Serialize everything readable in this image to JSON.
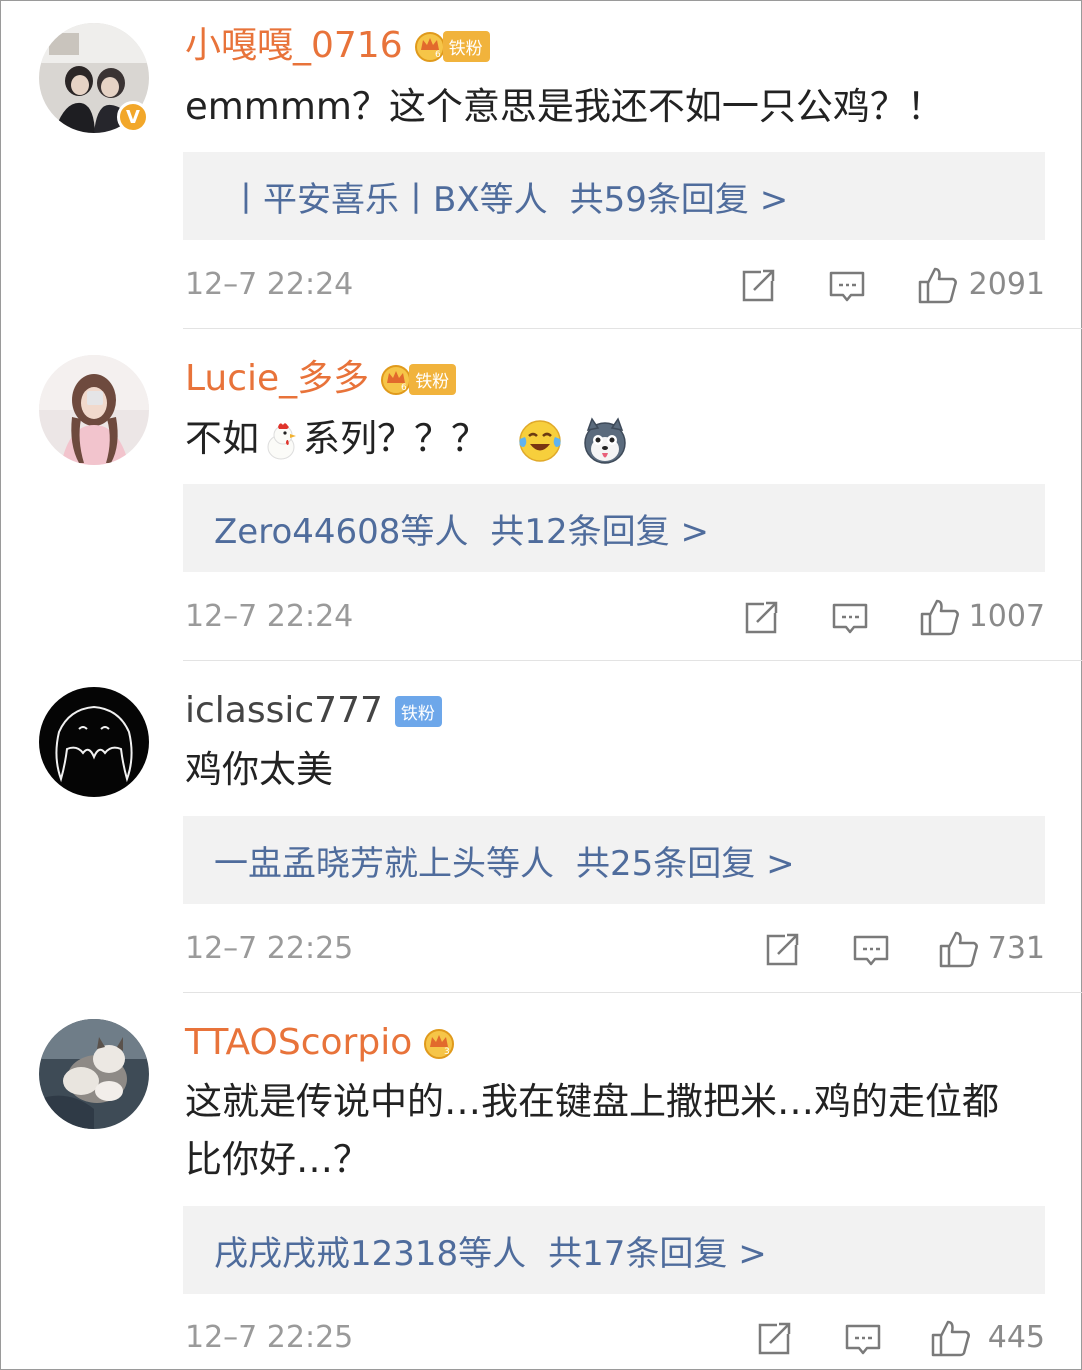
{
  "comments": [
    {
      "username": "小嘎嘎_0716",
      "badge": "铁粉",
      "text": "emmmm？这个意思是我还不如一只公鸡？！",
      "replies_prefix": "丨平安喜乐丨BX等人",
      "replies_total": "共59条回复 >",
      "time": "12–7 22:24",
      "likes": "2091"
    },
    {
      "username": "Lucie_多多",
      "badge": "铁粉",
      "text_before": "不如",
      "text_after": "系列？？？",
      "replies_prefix": "Zero44608等人",
      "replies_total": "共12条回复 >",
      "time": "12–7 22:24",
      "likes": "1007"
    },
    {
      "username": "iclassic777",
      "badge": "铁粉",
      "text": "鸡你太美",
      "replies_prefix": "一盅孟晓芳就上头等人",
      "replies_total": "共25条回复 >",
      "time": "12–7 22:25",
      "likes": "731"
    },
    {
      "username": "TTAOScorpio",
      "text_line1": "这就是传说中的…我在键盘上撒把米…鸡的走位都",
      "text_line2": "比你好…？",
      "replies_prefix": "戌戌戌戒12318等人",
      "replies_total": "共17条回复 >",
      "time": "12–7 22:25",
      "likes": "445"
    }
  ],
  "verified_mark": "V",
  "colors": {
    "username": "#e8733a",
    "reply_link": "#4f6c9c",
    "meta": "#9a9a9a",
    "reply_bg": "#f2f2f2",
    "fan_badge": "#f1b33c",
    "fan_badge_blue": "#6da7ea"
  },
  "icons": [
    "share-icon",
    "comment-icon",
    "like-icon",
    "crown-icon",
    "chicken-emoji",
    "laugh-cry-emoji",
    "husky-emoji"
  ]
}
